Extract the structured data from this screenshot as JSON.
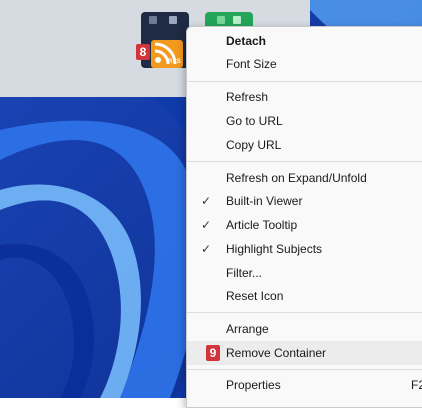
{
  "desktop": {
    "rss_tile": {
      "badge": "8",
      "label": "RSS"
    },
    "colors": {
      "wallpaper": "#1d52c6",
      "dock": "#d6dbe2",
      "rss_orange": "#f29a1e",
      "badge_red": "#d1343a",
      "green_tile": "#24a55a"
    }
  },
  "menu": {
    "items": [
      {
        "label": "Detach",
        "bold": true,
        "checked": false
      },
      {
        "label": "Font Size",
        "checked": false
      },
      {
        "label": "Refresh",
        "checked": false
      },
      {
        "label": "Go to URL",
        "checked": false
      },
      {
        "label": "Copy URL",
        "checked": false
      },
      {
        "label": "Refresh on Expand/Unfold",
        "checked": false
      },
      {
        "label": "Built-in Viewer",
        "checked": true
      },
      {
        "label": "Article Tooltip",
        "checked": true
      },
      {
        "label": "Highlight Subjects",
        "checked": true
      },
      {
        "label": "Filter...",
        "checked": false
      },
      {
        "label": "Reset Icon",
        "checked": false
      },
      {
        "label": "Arrange",
        "checked": false
      },
      {
        "label": "Remove Container",
        "checked": false,
        "highlighted": true,
        "badge": "9"
      },
      {
        "label": "Properties",
        "checked": false,
        "shortcut": "F2"
      }
    ],
    "check_glyph": "✓"
  }
}
